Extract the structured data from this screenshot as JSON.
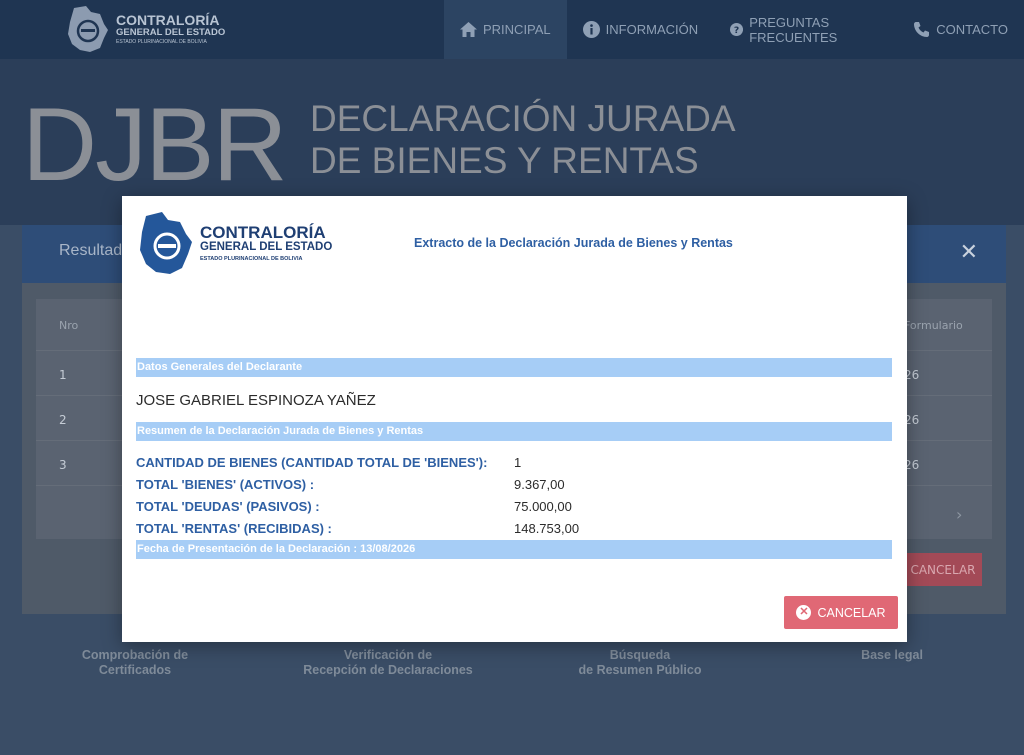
{
  "header": {
    "brand": {
      "line1": "CONTRALORÍA",
      "line2": "GENERAL DEL ESTADO",
      "line3": "ESTADO PLURINACIONAL DE BOLIVIA"
    },
    "nav": [
      {
        "label": "PRINCIPAL",
        "icon": "home-icon",
        "active": true
      },
      {
        "label": "INFORMACIÓN",
        "icon": "info-icon",
        "active": false
      },
      {
        "label": "PREGUNTAS FRECUENTES",
        "icon": "question-icon",
        "active": false
      },
      {
        "label": "CONTACTO",
        "icon": "phone-icon",
        "active": false
      }
    ]
  },
  "hero": {
    "acronym": "DJBR",
    "line1": "DECLARACIÓN JURADA",
    "line2": "DE BIENES Y RENTAS"
  },
  "background_card": {
    "title": "Resultado",
    "table": {
      "col_nro": "Nro",
      "col_form": "Formulario",
      "rows": [
        {
          "nro": "1",
          "form": "26"
        },
        {
          "nro": "2",
          "form": "26"
        },
        {
          "nro": "3",
          "form": "26"
        }
      ]
    },
    "cancel_label": "CANCELAR"
  },
  "footer_links": [
    {
      "line1": "Comprobación de",
      "line2": "Certificados"
    },
    {
      "line1": "Verificación de",
      "line2": "Recepción de Declaraciones"
    },
    {
      "line1": "Búsqueda",
      "line2": "de Resumen Público"
    },
    {
      "line1": "Base legal",
      "line2": ""
    }
  ],
  "modal": {
    "logo": {
      "line1": "CONTRALORÍA",
      "line2": "GENERAL DEL ESTADO",
      "line3": "ESTADO PLURINACIONAL DE BOLIVIA"
    },
    "heading": "Extracto de la Declaración Jurada de Bienes y Rentas",
    "section_general": "Datos Generales del Declarante",
    "declarant_name": "JOSE GABRIEL ESPINOZA YAÑEZ",
    "section_summary": "Resumen de la Declaración Jurada de Bienes y Rentas",
    "rows": [
      {
        "label": "CANTIDAD DE BIENES (CANTIDAD TOTAL DE 'BIENES'):",
        "value": "1"
      },
      {
        "label": "TOTAL 'BIENES' (ACTIVOS) :",
        "value": "9.367,00"
      },
      {
        "label": "TOTAL 'DEUDAS' (PASIVOS) :",
        "value": "75.000,00"
      },
      {
        "label": "TOTAL 'RENTAS' (RECIBIDAS) :",
        "value": "148.753,00"
      }
    ],
    "presentation_date": "Fecha de Presentación de la Declaración : 13/08/2026",
    "cancel_label": "CANCELAR"
  },
  "colors": {
    "nav_bg": "#1f3552",
    "band": "#a6cdf6",
    "accent_blue": "#2e5fa3",
    "cancel_red": "#e06875"
  }
}
